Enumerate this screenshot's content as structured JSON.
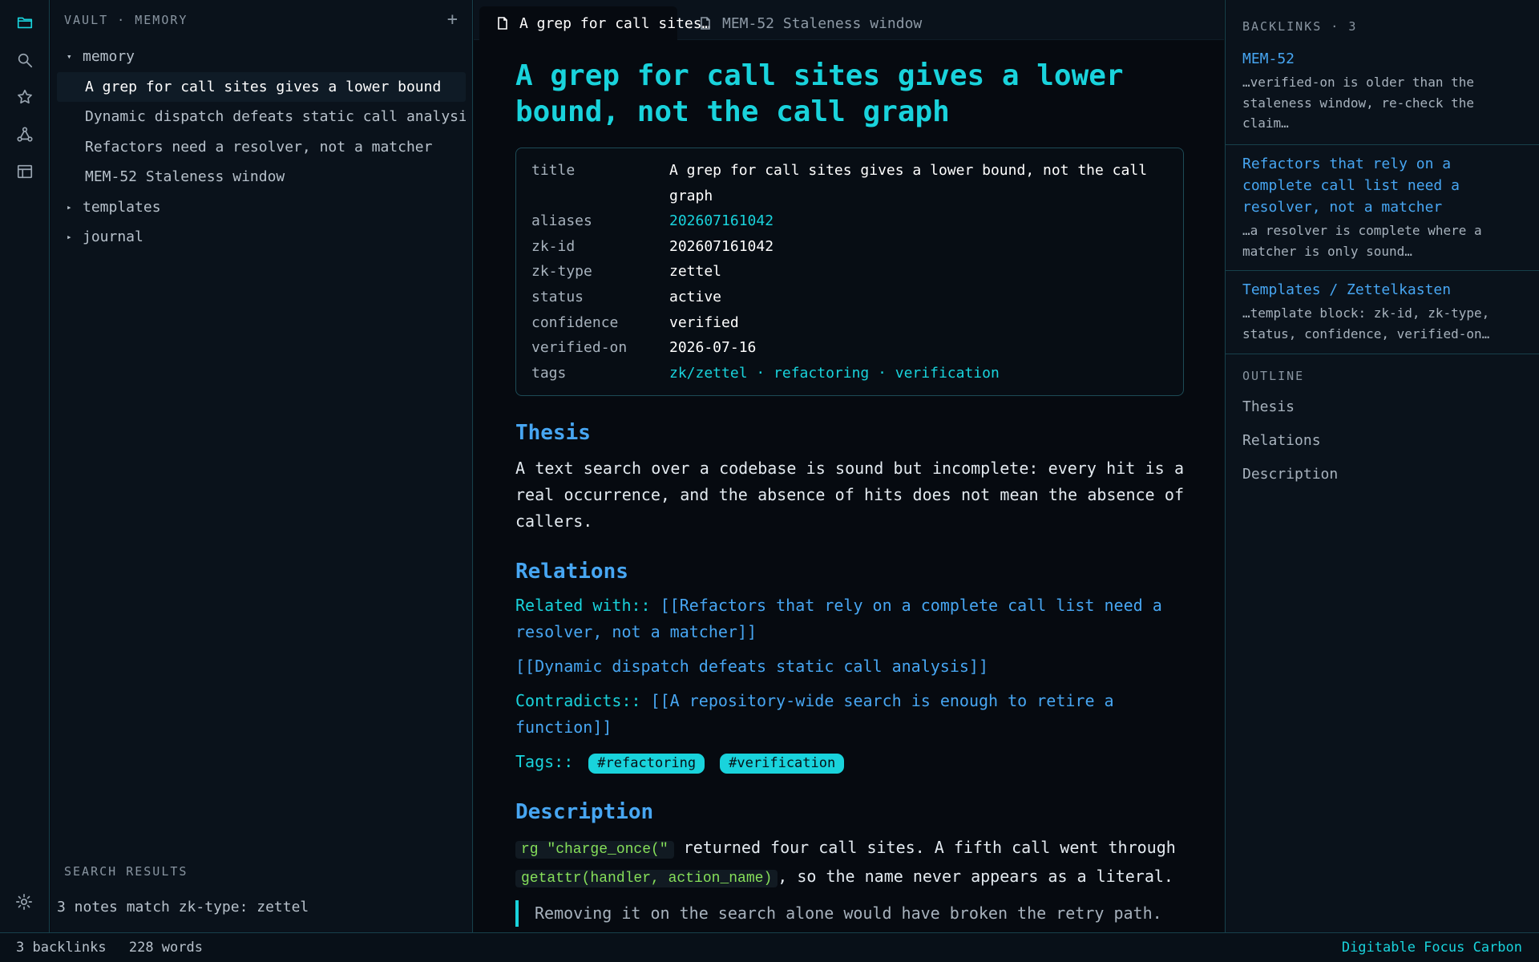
{
  "explorer": {
    "title": "VAULT · MEMORY",
    "add_label": "+",
    "tree": [
      {
        "type": "folder",
        "label": "memory",
        "caret": "▾",
        "expanded": true
      },
      {
        "type": "file",
        "label": "A grep for call sites gives a lower bound",
        "active": true
      },
      {
        "type": "file",
        "label": "Dynamic dispatch defeats static call analysis"
      },
      {
        "type": "file",
        "label": "Refactors need a resolver, not a matcher"
      },
      {
        "type": "file",
        "label": "MEM-52 Staleness window"
      },
      {
        "type": "folder",
        "label": "templates",
        "caret": "▸"
      },
      {
        "type": "folder",
        "label": "journal",
        "caret": "▸"
      }
    ],
    "search_results_label": "SEARCH RESULTS",
    "search_results_count": "3 notes match zk-type: zettel"
  },
  "tabs": [
    {
      "label": "A grep for call sites…",
      "active": true
    },
    {
      "label": "MEM-52 Staleness window",
      "active": false
    }
  ],
  "note": {
    "title": "A grep for call sites gives a lower bound, not the call graph",
    "properties": [
      {
        "key": "title",
        "value": "A grep for call sites gives a lower bound, not the call graph"
      },
      {
        "key": "aliases",
        "value": "202607161042"
      },
      {
        "key": "zk-id",
        "value": "202607161042"
      },
      {
        "key": "zk-type",
        "value": "zettel"
      },
      {
        "key": "status",
        "value": "active"
      },
      {
        "key": "confidence",
        "value": "verified"
      },
      {
        "key": "verified-on",
        "value": "2026-07-16"
      },
      {
        "key": "tags",
        "value": "zk/zettel · refactoring · verification"
      }
    ],
    "thesis_heading": "Thesis",
    "thesis_text": "A text search over a codebase is sound but incomplete: every hit is a real occurrence, and the absence of hits does not mean the absence of callers.",
    "relations_heading": "Relations",
    "related_with_key": "Related with::",
    "related_with_link": "[[Refactors that rely on a complete call list need a resolver, not a matcher]]",
    "related_link_2": "[[Dynamic dispatch defeats static call analysis]]",
    "contradicts_key": "Contradicts::",
    "contradicts_link": "[[A repository-wide search is enough to retire a function]]",
    "tags_key": "Tags::",
    "tag_pills": [
      "#refactoring",
      "#verification"
    ],
    "description_heading": "Description",
    "desc_code_1": "rg \"charge_once(\"",
    "desc_text_1": " returned four call sites. A fifth call went through ",
    "desc_code_2": "getattr(handler, action_name)",
    "desc_text_2": ", so the name never appears as a literal.",
    "quote": "Removing it on the search alone would have broken the retry path."
  },
  "backlinks": {
    "label": "BACKLINKS · 3",
    "items": [
      {
        "title": "MEM-52",
        "snippet": "…verified-on is older than the staleness window, re-check the claim…"
      },
      {
        "title": "Refactors that rely on a complete call list need a resolver, not a matcher",
        "snippet": "…a resolver is complete where a matcher is only sound…"
      },
      {
        "title": "Templates / Zettelkasten",
        "snippet": "…template block: zk-id, zk-type, status, confidence, verified-on…"
      }
    ]
  },
  "outline": {
    "label": "OUTLINE",
    "items": [
      "Thesis",
      "Relations",
      "Description"
    ]
  },
  "status": {
    "backlinks": "3 backlinks",
    "words": "228 words",
    "theme": "Digitable Focus Carbon"
  },
  "colors": {
    "accent": "#19d3dc",
    "link": "#47a6f2",
    "code": "#86e05a",
    "background": "#060a10",
    "panel": "#0a121b"
  },
  "icons": [
    "folder-icon",
    "search-icon",
    "star-icon",
    "graph-icon",
    "table-icon",
    "gear-icon",
    "file-icon"
  ]
}
